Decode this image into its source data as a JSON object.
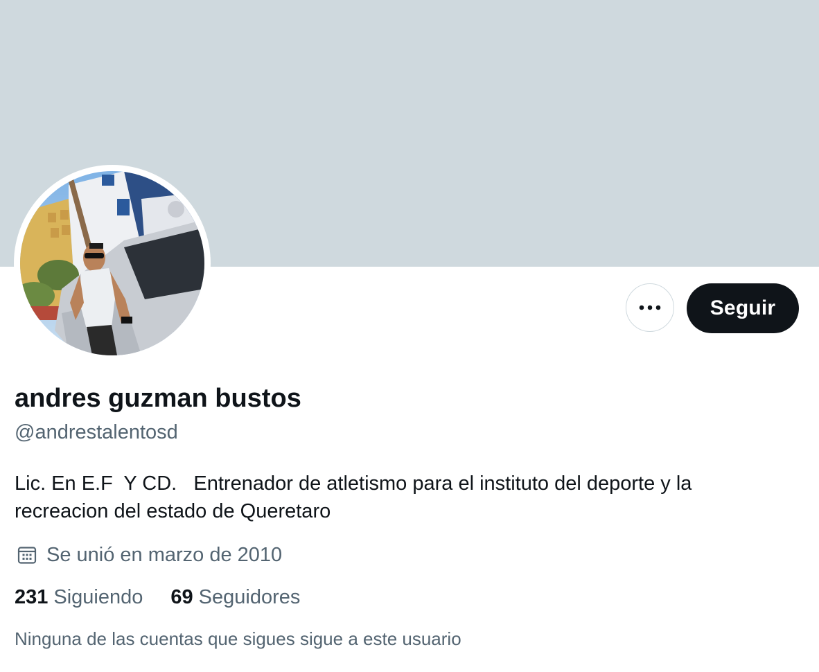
{
  "profile": {
    "display_name": "andres guzman bustos",
    "handle": "@andrestalentosd",
    "bio": "Lic. En E.F  Y CD.   Entrenador de atletismo para el instituto del deporte y la recreacion del estado de Queretaro",
    "joined_text": "Se unió en marzo de 2010",
    "following_count": "231",
    "following_label": "Siguiendo",
    "followers_count": "69",
    "followers_label": "Seguidores",
    "followers_you_know": "Ninguna de las cuentas que sigues sigue a este usuario"
  },
  "actions": {
    "follow_label": "Seguir",
    "more_icon": "more-horizontal-icon"
  },
  "icons": {
    "joined_icon": "calendar-icon"
  },
  "colors": {
    "banner": "#cfd9de",
    "primary_text": "#0f1419",
    "secondary_text": "#536471",
    "follow_button_bg": "#0f1419",
    "follow_button_text": "#ffffff"
  }
}
